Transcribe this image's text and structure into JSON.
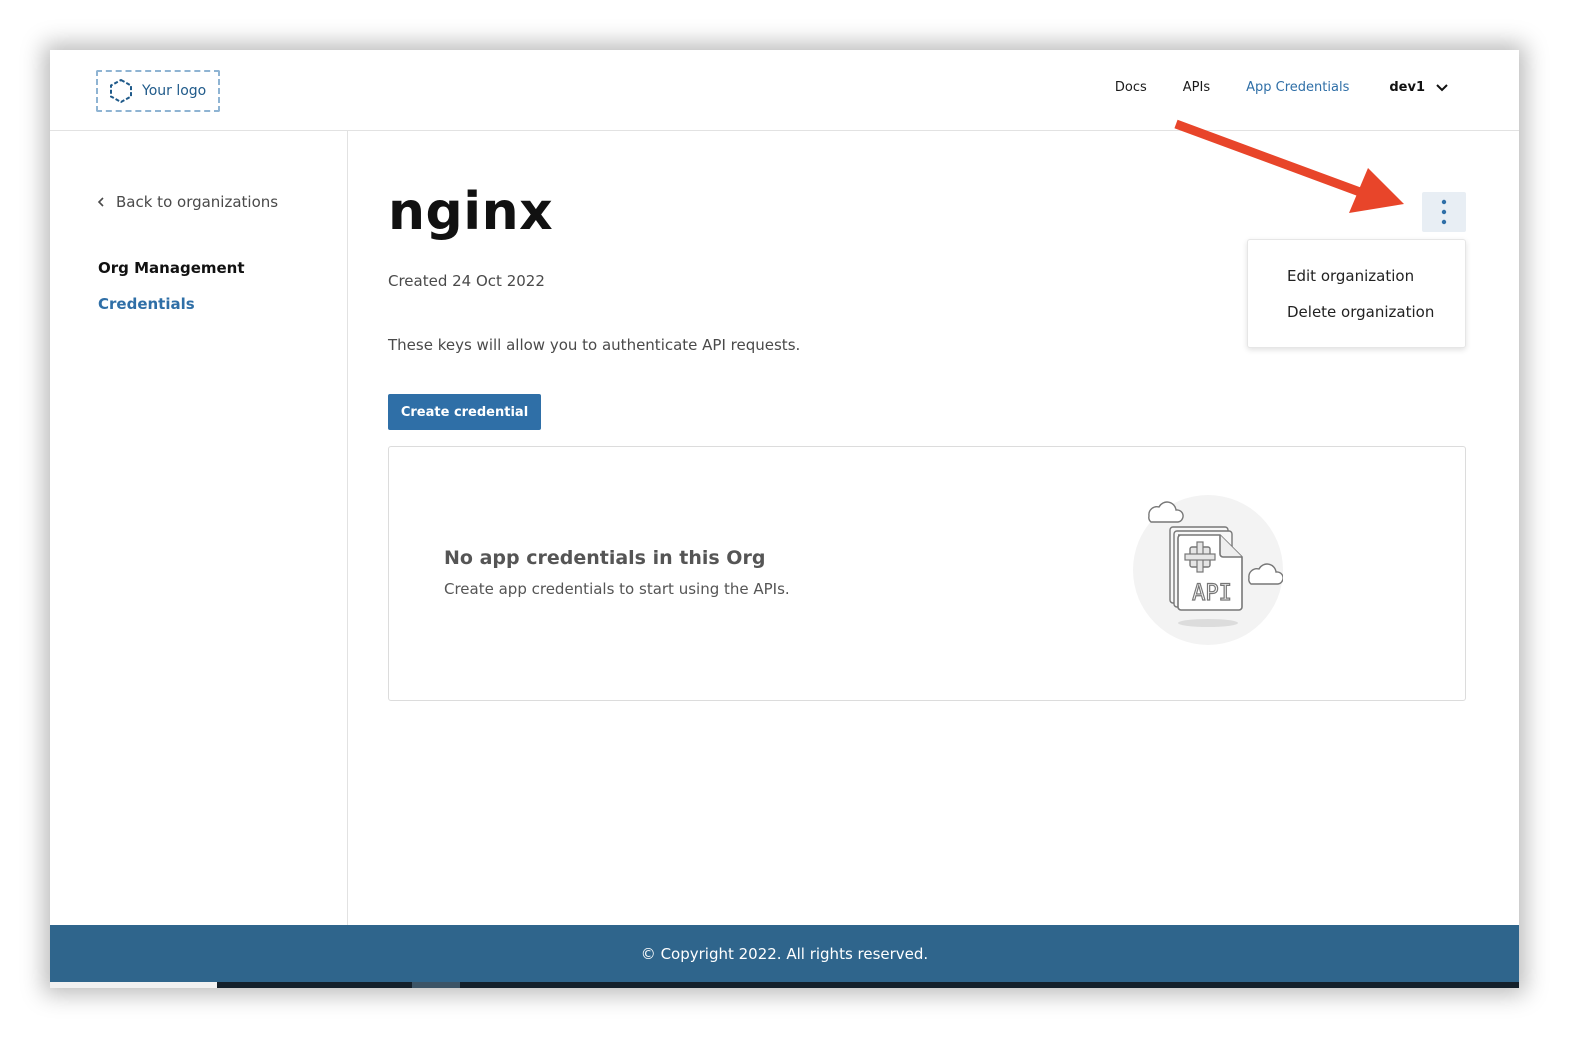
{
  "header": {
    "logo_text": "Your logo",
    "nav": [
      {
        "label": "Docs"
      },
      {
        "label": "APIs"
      },
      {
        "label": "App Credentials"
      }
    ],
    "user_label": "dev1"
  },
  "sidebar": {
    "back_label": "Back to organizations",
    "heading": "Org Management",
    "items": [
      {
        "label": "Credentials"
      }
    ]
  },
  "main": {
    "org_name": "nginx",
    "created": "Created 24 Oct 2022",
    "description": "These keys will allow you to authenticate API requests.",
    "create_button": "Create credential",
    "empty_state": {
      "title": "No app credentials in this Org",
      "subtitle": "Create app credentials to start using the APIs.",
      "illustration_label": "API"
    }
  },
  "org_menu": {
    "items": [
      {
        "label": "Edit organization"
      },
      {
        "label": "Delete organization"
      }
    ]
  },
  "footer": {
    "copyright": "© Copyright 2022. All rights reserved."
  },
  "colors": {
    "accent": "#2f6fa7",
    "footer_bg": "#2f658c",
    "annotation_arrow": "#e8452a"
  },
  "icons": {
    "logo": "hexagon-logo-icon",
    "back": "chevron-left-icon",
    "user_menu": "chevron-down-icon",
    "org_actions": "kebab-menu-icon",
    "empty_state": "api-document-icon"
  }
}
